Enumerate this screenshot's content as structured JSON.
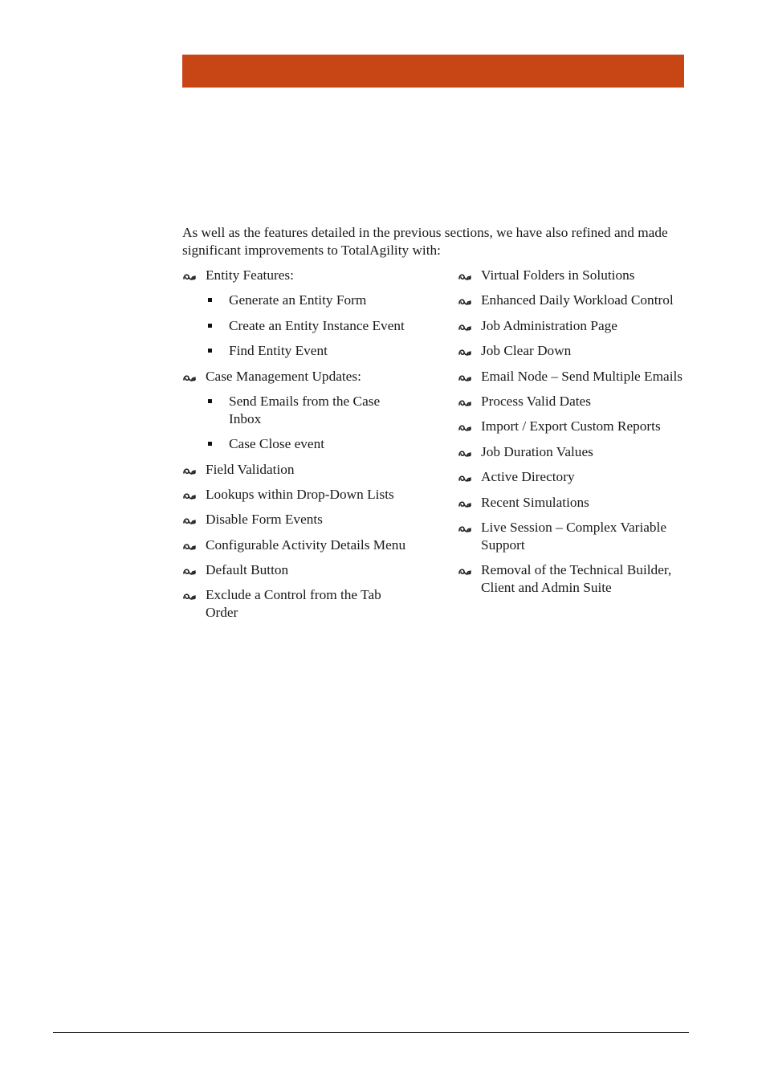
{
  "banner": {
    "color": "#c84516"
  },
  "intro": "As well as the features detailed in the previous sections, we have also refined and made significant improvements to TotalAgility with:",
  "left_column": [
    {
      "label": "Entity Features:",
      "bullet_icon": "ornament-bullet-icon",
      "children": [
        "Generate an Entity Form",
        "Create an Entity Instance Event",
        "Find Entity Event"
      ]
    },
    {
      "label": "Case Management Updates:",
      "bullet_icon": "ornament-bullet-icon",
      "children": [
        "Send Emails from the Case Inbox",
        "Case Close event"
      ]
    },
    {
      "label": "Field Validation",
      "bullet_icon": "ornament-bullet-icon"
    },
    {
      "label": "Lookups within Drop-Down Lists",
      "bullet_icon": "ornament-bullet-icon"
    },
    {
      "label": "Disable Form Events",
      "bullet_icon": "ornament-bullet-icon"
    },
    {
      "label": "Configurable Activity Details Menu",
      "bullet_icon": "ornament-bullet-icon"
    },
    {
      "label": "Default Button",
      "bullet_icon": "ornament-bullet-icon"
    },
    {
      "label": "Exclude a Control from the Tab Order",
      "bullet_icon": "ornament-bullet-icon"
    }
  ],
  "right_column": [
    {
      "label": "Virtual Folders in Solutions"
    },
    {
      "label": "Enhanced Daily Workload Control"
    },
    {
      "label": "Job Administration Page"
    },
    {
      "label": "Job Clear Down"
    },
    {
      "label": "Email Node – Send Multiple Emails"
    },
    {
      "label": "Process Valid Dates"
    },
    {
      "label": "Import / Export Custom Reports"
    },
    {
      "label": "Job Duration Values"
    },
    {
      "label": "Active Directory"
    },
    {
      "label": "Recent Simulations"
    },
    {
      "label": "Live Session – Complex Variable Support"
    },
    {
      "label": "Removal of the Technical Builder, Client and Admin Suite"
    }
  ]
}
